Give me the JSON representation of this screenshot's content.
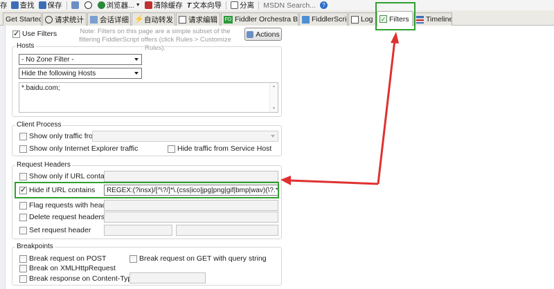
{
  "toolbar": {
    "items": [
      {
        "label": "查找",
        "icon": "find-icon",
        "color": "#3b6fb5"
      },
      {
        "label": "保存",
        "icon": "save-icon",
        "color": "#3b6fb5"
      },
      {
        "label": "浏览器...",
        "icon": "browser-icon",
        "color": "#2a8a3a"
      },
      {
        "label": "清除缓存",
        "icon": "clear-cache-icon",
        "color": "#c03030"
      },
      {
        "label": "文本向导",
        "icon": "text-wizard-icon",
        "color": "#4a4a4a"
      },
      {
        "label": "分离",
        "icon": "detach-icon",
        "color": "#4a4a4a"
      }
    ],
    "search_label": "MSDN Search..."
  },
  "tabs": [
    {
      "label": "Get Started",
      "icon": ""
    },
    {
      "label": "请求统计",
      "icon": "statistics-icon"
    },
    {
      "label": "会话详细",
      "icon": "inspectors-icon"
    },
    {
      "label": "自动转发",
      "icon": "autoresponder-icon"
    },
    {
      "label": "请求编辑",
      "icon": "composer-icon"
    },
    {
      "label": "Fiddler Orchestra Beta",
      "icon": "orchestra-icon"
    },
    {
      "label": "FiddlerScript",
      "icon": "fiddlerscript-icon"
    },
    {
      "label": "Log",
      "icon": "log-icon"
    },
    {
      "label": "Filters",
      "icon": "filters-check-icon"
    },
    {
      "label": "Timeline",
      "icon": "timeline-icon"
    }
  ],
  "use_filters": {
    "label": "Use Filters",
    "checked": true
  },
  "note": "Note: Filters on this page are a simple subset of the filtering FiddlerScript offers (click Rules > Customize Rules).",
  "actions_button": "Actions",
  "hosts": {
    "title": "Hosts",
    "zone_filter": "- No Zone Filter -",
    "host_filter": "Hide the following Hosts",
    "host_list": "*.baidu.com;"
  },
  "client_process": {
    "title": "Client Process",
    "show_only_from": {
      "label": "Show only traffic from",
      "checked": false
    },
    "show_only_ie": {
      "label": "Show only Internet Explorer traffic",
      "checked": false
    },
    "hide_service_host": {
      "label": "Hide traffic from Service Host",
      "checked": false
    }
  },
  "request_headers": {
    "title": "Request Headers",
    "show_if_url": {
      "label": "Show only if URL contains",
      "checked": false,
      "value": ""
    },
    "hide_if_url": {
      "label": "Hide if URL contains",
      "checked": true,
      "value": "REGEX:(?insx)/[^\\?/]*\\.(css|ico|jpg|png|gif|bmp|wav)(\\?.*)?$"
    },
    "flag_with_headers": {
      "label": "Flag requests with headers",
      "checked": false
    },
    "delete_headers": {
      "label": "Delete request headers",
      "checked": false
    },
    "set_header": {
      "label": "Set request header",
      "checked": false
    }
  },
  "breakpoints": {
    "title": "Breakpoints",
    "break_post": {
      "label": "Break request on POST",
      "checked": false
    },
    "break_get_query": {
      "label": "Break request on GET with query string",
      "checked": false
    },
    "break_xhr": {
      "label": "Break on XMLHttpRequest",
      "checked": false
    },
    "break_content_type": {
      "label": "Break response on Content-Type",
      "checked": false
    }
  },
  "annotation_colors": {
    "highlight": "#2ea02e",
    "arrow": "#e03030"
  }
}
